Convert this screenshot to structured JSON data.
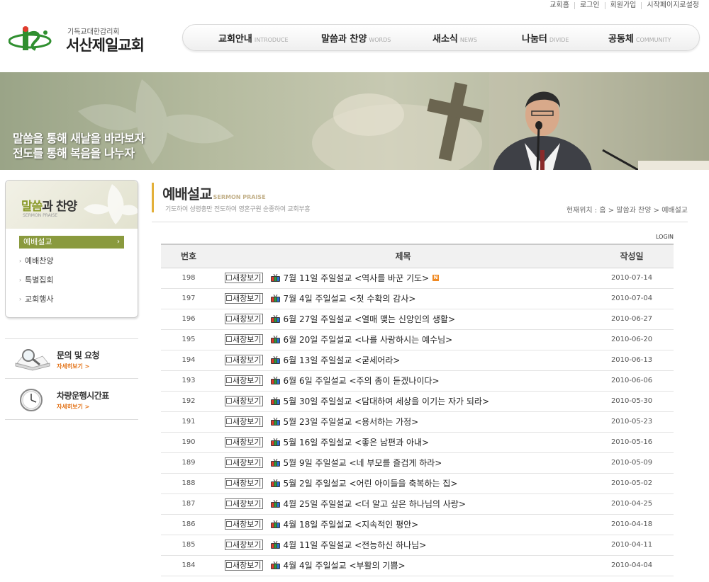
{
  "util_links": [
    "교회홈",
    "로그인",
    "회원가입",
    "시작페이지로설정"
  ],
  "logo": {
    "sub": "기독교대한감리회",
    "name": "서산제일교회"
  },
  "nav": [
    {
      "ko": "교회안내",
      "en": "INTRODUCE"
    },
    {
      "ko": "말씀과 찬양",
      "en": "WORDS"
    },
    {
      "ko": "새소식",
      "en": "NEWS"
    },
    {
      "ko": "나눔터",
      "en": "DIVIDE"
    },
    {
      "ko": "공동체",
      "en": "COMMUNITY"
    }
  ],
  "banner": {
    "slogan1": "말씀을 통해 새날을 바라보자",
    "slogan2": "전도를 통해 복음을 나누자"
  },
  "side": {
    "title_a": "말씀",
    "title_b": "과 찬양",
    "title_en": "SERMON PRAISE",
    "items": [
      "예배설교",
      "예배찬양",
      "특별집회",
      "교회행사"
    ]
  },
  "info_boxes": [
    {
      "title": "문의 및 요청",
      "more": "자세히보기 >"
    },
    {
      "title": "차량운행시간표",
      "more": "자세히보기 >"
    }
  ],
  "page": {
    "title": "예배설교",
    "title_en": "SERMON PRAISE",
    "desc": "기도하여 성령충만  전도하여 영혼구원  순종하여 교회부흥",
    "breadcrumb": "현재위치 : 홈 > 말씀과 찬양 > 예배설교"
  },
  "login_label": "LOGIN",
  "board": {
    "headers": {
      "num": "번호",
      "subject": "제목",
      "date": "작성일"
    },
    "newwin_label": "새창보기",
    "new_badge": "N",
    "rows": [
      {
        "num": "198",
        "subject": "7월 11일 주일설교 <역사를 바꾼 기도>",
        "date": "2010-07-14",
        "is_new": true
      },
      {
        "num": "197",
        "subject": "7월 4일 주일설교 <첫 수확의 감사>",
        "date": "2010-07-04"
      },
      {
        "num": "196",
        "subject": "6월 27일 주일설교 <열매 맺는 신앙인의 생활>",
        "date": "2010-06-27"
      },
      {
        "num": "195",
        "subject": "6월 20일 주일설교 <나를 사랑하시는 예수님>",
        "date": "2010-06-20"
      },
      {
        "num": "194",
        "subject": "6월 13일 주일설교 <굳세어라>",
        "date": "2010-06-13"
      },
      {
        "num": "193",
        "subject": "6월 6일 주일설교 <주의 종이 듣겠나이다>",
        "date": "2010-06-06"
      },
      {
        "num": "192",
        "subject": "5월 30일 주일설교 <담대하여 세상을 이기는 자가 되라>",
        "date": "2010-05-30"
      },
      {
        "num": "191",
        "subject": "5월 23일 주일설교 <용서하는 가정>",
        "date": "2010-05-23"
      },
      {
        "num": "190",
        "subject": "5월 16일 주일설교 <좋은 남편과 아내>",
        "date": "2010-05-16"
      },
      {
        "num": "189",
        "subject": "5월 9일 주일설교 <네 부모를 즐겁게 하라>",
        "date": "2010-05-09"
      },
      {
        "num": "188",
        "subject": "5월 2일 주일설교 <어린 아이들을 축복하는 집>",
        "date": "2010-05-02"
      },
      {
        "num": "187",
        "subject": "4월 25일 주일설교 <더 알고 싶은 하나님의 사랑>",
        "date": "2010-04-25"
      },
      {
        "num": "186",
        "subject": "4월 18일 주일설교 <지속적인 평안>",
        "date": "2010-04-18"
      },
      {
        "num": "185",
        "subject": "4월 11일 주일설교 <전능하신 하나님>",
        "date": "2010-04-11"
      },
      {
        "num": "184",
        "subject": "4월 4일 주일설교 <부활의 기쁨>",
        "date": "2010-04-04"
      }
    ]
  }
}
